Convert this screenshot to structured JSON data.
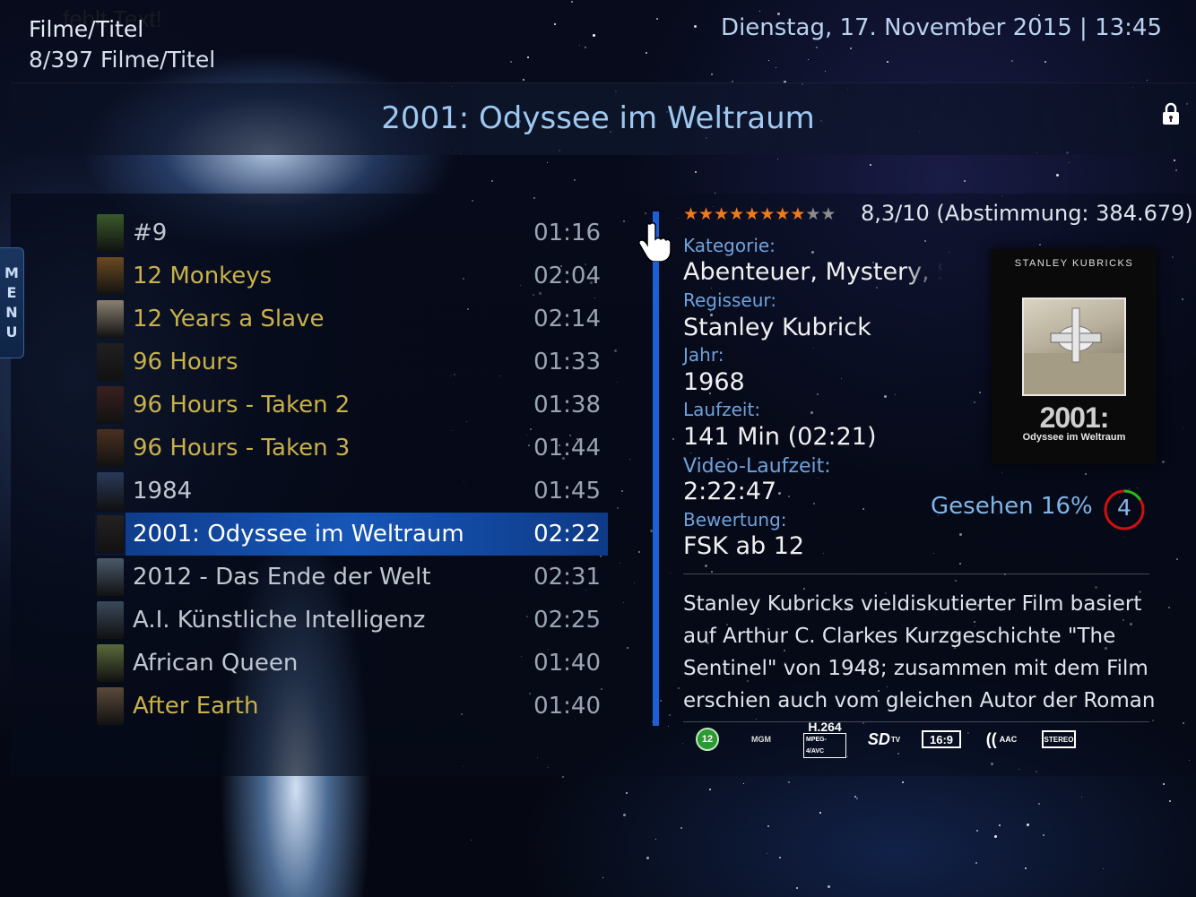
{
  "header": {
    "section": "Filme/Titel",
    "count": "8/397 Filme/Titel",
    "missing_text": "fehlt Text!",
    "datetime": "Dienstag, 17. November 2015 | 13:45"
  },
  "title": "2001: Odyssee im Weltraum",
  "menu_tab_letters": [
    "M",
    "E",
    "N",
    "U"
  ],
  "movies": [
    {
      "name": "#9",
      "time": "01:16",
      "color": "grey",
      "thumb": "#3a5a2a"
    },
    {
      "name": "12 Monkeys",
      "time": "02:04",
      "color": "yellow",
      "thumb": "#6b4a22"
    },
    {
      "name": "12 Years a Slave",
      "time": "02:14",
      "color": "yellow",
      "thumb": "#8a8070"
    },
    {
      "name": "96 Hours",
      "time": "01:33",
      "color": "yellow",
      "thumb": "#202020"
    },
    {
      "name": "96 Hours - Taken 2",
      "time": "01:38",
      "color": "yellow",
      "thumb": "#3a2020"
    },
    {
      "name": "96 Hours - Taken 3",
      "time": "01:44",
      "color": "yellow",
      "thumb": "#4a3020"
    },
    {
      "name": "1984",
      "time": "01:45",
      "color": "grey",
      "thumb": "#2a3a5a"
    },
    {
      "name": "2001: Odyssee im Weltraum",
      "time": "02:22",
      "color": "selected",
      "thumb": "#222"
    },
    {
      "name": "2012 - Das Ende der Welt",
      "time": "02:31",
      "color": "grey",
      "thumb": "#4a5a6a"
    },
    {
      "name": "A.I. Künstliche Intelligenz",
      "time": "02:25",
      "color": "grey",
      "thumb": "#3a4a5a"
    },
    {
      "name": "African Queen",
      "time": "01:40",
      "color": "grey",
      "thumb": "#5a6a3a"
    },
    {
      "name": "After Earth",
      "time": "01:40",
      "color": "yellow",
      "thumb": "#5a4a3a"
    }
  ],
  "rating": {
    "stars_on": 8,
    "stars_total": 10,
    "text": "8,3/10 (Abstimmung:  384.679)"
  },
  "details": {
    "kategorie_label": "Kategorie:",
    "kategorie": "Abenteuer, Mystery, Science Fiction",
    "regisseur_label": "Regisseur:",
    "regisseur": "Stanley Kubrick",
    "jahr_label": "Jahr:",
    "jahr": "1968",
    "laufzeit_label": "Laufzeit:",
    "laufzeit": "141 Min (02:21)",
    "video_laufzeit_label": "Video-Laufzeit:",
    "video_laufzeit": "2:22:47",
    "bewertung_label": "Bewertung:",
    "bewertung": "FSK ab 12"
  },
  "poster": {
    "studio": "STANLEY KUBRICKS",
    "title_big": "2001:",
    "title_sub": "Odyssee im Weltraum"
  },
  "watched": {
    "text": "Gesehen 16%",
    "count": "4",
    "fraction": 0.16
  },
  "plot": "Stanley Kubricks vieldiskutierter Film basiert auf Arthur C. Clarkes Kurzgeschichte \"The Sentinel\" von 1948; zusammen mit dem Film erschien auch vom gleichen Autor der Roman",
  "flags": {
    "fsk": "12",
    "studio": "MGM",
    "codec": "H.264",
    "codec_sub": "MPEG-4/AVC",
    "resolution": "SD",
    "resolution_sub": "TV",
    "aspect": "16:9",
    "audio": "AAC",
    "channels": "STEREO"
  },
  "colors": {
    "accent": "#1c5fd6",
    "label_blue": "#6fa2dc",
    "title_blue": "#9ec8f0",
    "yellow_text": "#c8b04a",
    "star_on": "#f07a1e"
  }
}
